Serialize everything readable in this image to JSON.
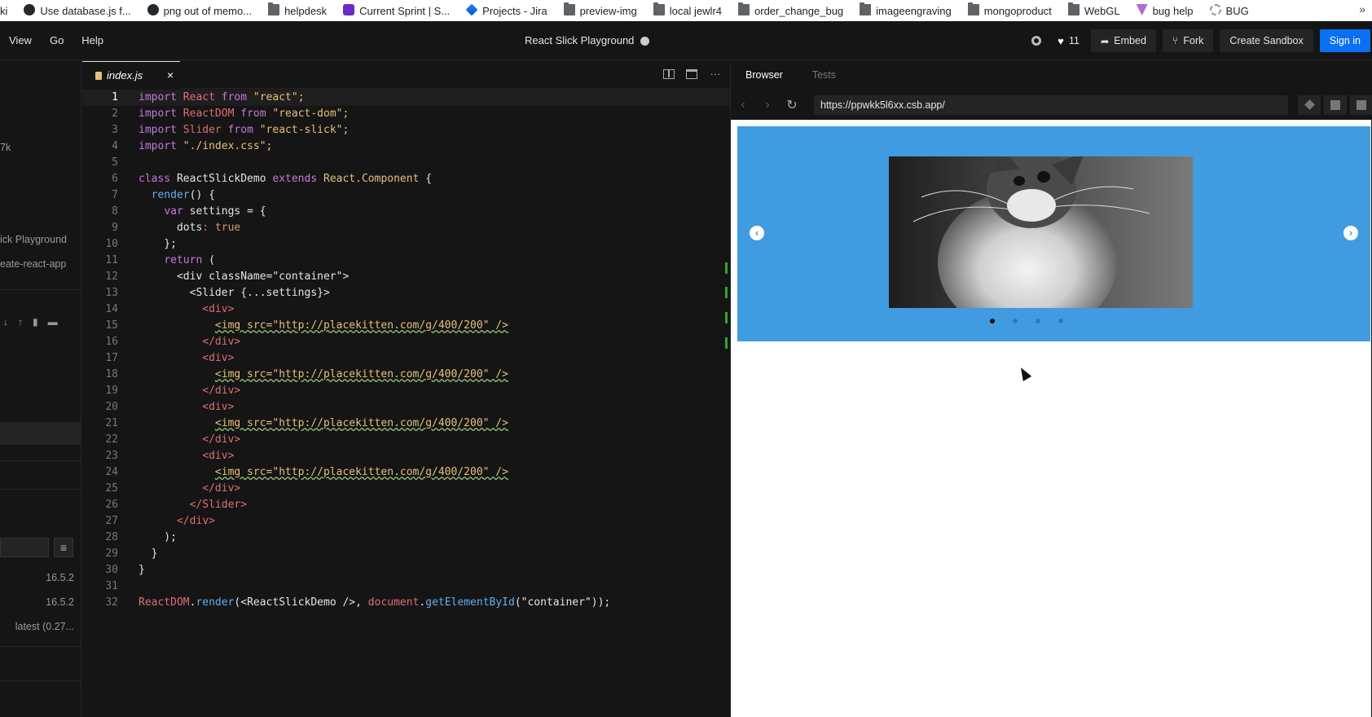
{
  "bookmarks": [
    {
      "label": "ki",
      "icon": "none"
    },
    {
      "label": "Use database.js f...",
      "icon": "github-icon"
    },
    {
      "label": "png out of memo...",
      "icon": "github-icon"
    },
    {
      "label": "helpdesk",
      "icon": "folder-icon"
    },
    {
      "label": "Current Sprint | S...",
      "icon": "sprint-icon"
    },
    {
      "label": "Projects - Jira",
      "icon": "jira-icon"
    },
    {
      "label": "preview-img",
      "icon": "folder-icon"
    },
    {
      "label": "local jewlr4",
      "icon": "folder-icon"
    },
    {
      "label": "order_change_bug",
      "icon": "folder-icon"
    },
    {
      "label": "imageengraving",
      "icon": "folder-icon"
    },
    {
      "label": "mongoproduct",
      "icon": "folder-icon"
    },
    {
      "label": "WebGL",
      "icon": "folder-icon"
    },
    {
      "label": "bug help",
      "icon": "bug-icon"
    },
    {
      "label": "BUG",
      "icon": "gear-icon"
    }
  ],
  "bookmarks_more": "»",
  "menu": {
    "view": "View",
    "go": "Go",
    "help": "Help"
  },
  "header": {
    "title": "React Slick Playground",
    "likes": "11",
    "embed": "Embed",
    "fork": "Fork",
    "create": "Create Sandbox",
    "signin": "Sign in"
  },
  "sidebar": {
    "size": "7k",
    "sandbox_name": "ick Playground",
    "template": "eate-react-app",
    "dep1_version": "16.5.2",
    "dep2_version": "16.5.2",
    "dep3_version": "latest (0.27...",
    "menu_icon": "≡"
  },
  "editor": {
    "tab_label": "index.js",
    "tab_close": "×",
    "more_icon": "···"
  },
  "code_lines": [
    {
      "n": "1"
    },
    {
      "n": "2"
    },
    {
      "n": "3"
    },
    {
      "n": "4"
    },
    {
      "n": "5"
    },
    {
      "n": "6"
    },
    {
      "n": "7"
    },
    {
      "n": "8"
    },
    {
      "n": "9"
    },
    {
      "n": "10"
    },
    {
      "n": "11"
    },
    {
      "n": "12"
    },
    {
      "n": "13"
    },
    {
      "n": "14"
    },
    {
      "n": "15"
    },
    {
      "n": "16"
    },
    {
      "n": "17"
    },
    {
      "n": "18"
    },
    {
      "n": "19"
    },
    {
      "n": "20"
    },
    {
      "n": "21"
    },
    {
      "n": "22"
    },
    {
      "n": "23"
    },
    {
      "n": "24"
    },
    {
      "n": "25"
    },
    {
      "n": "26"
    },
    {
      "n": "27"
    },
    {
      "n": "28"
    },
    {
      "n": "29"
    },
    {
      "n": "30"
    },
    {
      "n": "31"
    },
    {
      "n": "32"
    }
  ],
  "code": {
    "l1": [
      "import",
      " React ",
      "from",
      " \"react\";"
    ],
    "l2": [
      "import",
      " ReactDOM ",
      "from",
      " \"react-dom\";"
    ],
    "l3": [
      "import",
      " Slider ",
      "from",
      " \"react-slick\";"
    ],
    "l4": [
      "import",
      " \"./index.css\";"
    ],
    "l6": [
      "class",
      " ReactSlickDemo ",
      "extends",
      " React.Component",
      " {"
    ],
    "l7": "  render() {",
    "l8": [
      "    ",
      "var",
      " settings = {"
    ],
    "l9": [
      "      dots",
      ": ",
      "true"
    ],
    "l10": "    };",
    "l11": [
      "    ",
      "return",
      " ("
    ],
    "l12": "      <div className=\"container\">",
    "l13": "        <Slider {...settings}>",
    "l14": "          <div>",
    "l15": "<img src=\"http://placekitten.com/g/400/200\" />",
    "l16": "          </div>",
    "l26": "        </Slider>",
    "l27": "      </div>",
    "l28": "    );",
    "l29": "  }",
    "l30": "}",
    "l32": [
      "ReactDOM",
      ".",
      "render",
      "(<ReactSlickDemo />, ",
      "document",
      ".",
      "getElementById",
      "(\"container\"));"
    ]
  },
  "preview": {
    "tab_browser": "Browser",
    "tab_tests": "Tests",
    "url": "https://ppwkk5l6xx.csb.app/",
    "back": "‹",
    "forward": "›",
    "refresh": "↻",
    "prev_arrow": "‹",
    "next_arrow": "›",
    "slider_bg": "#419be0",
    "slide_count": 4,
    "active_dot": 0
  }
}
